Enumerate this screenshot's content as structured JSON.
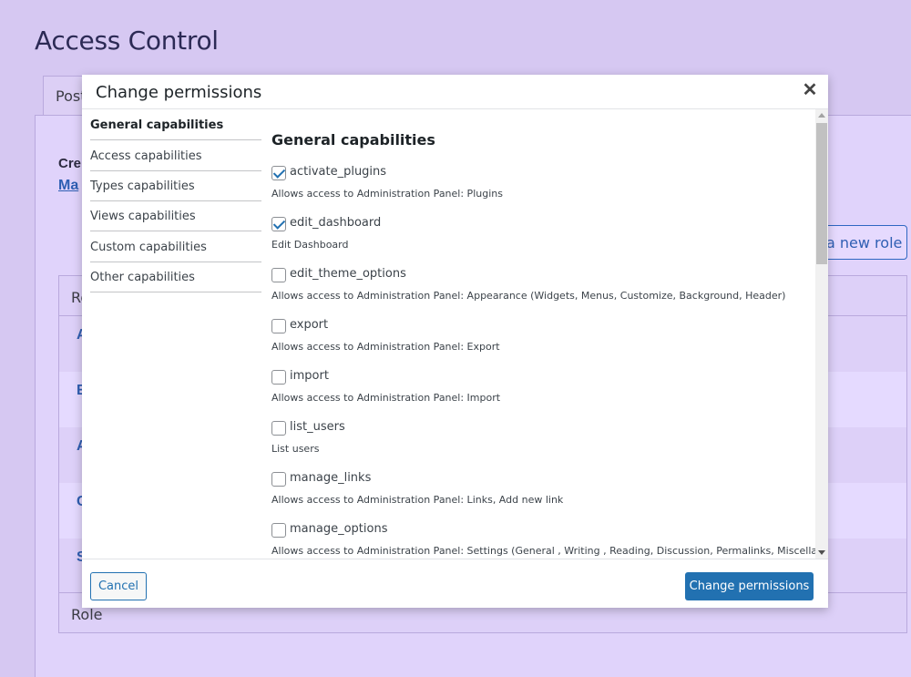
{
  "background": {
    "page_title": "Access Control",
    "tab_label": "Post",
    "create_text": "Cre",
    "manage_link": "Ma",
    "add_role_button": "a new role",
    "table_header": "Ro",
    "table_footer": "Role",
    "row_letters": [
      "A",
      "E",
      "A",
      "C",
      "S"
    ]
  },
  "modal": {
    "title": "Change permissions",
    "close_glyph": "✕",
    "nav_items": [
      {
        "label": "General capabilities",
        "active": true
      },
      {
        "label": "Access capabilities",
        "active": false
      },
      {
        "label": "Types capabilities",
        "active": false
      },
      {
        "label": "Views capabilities",
        "active": false
      },
      {
        "label": "Custom capabilities",
        "active": false
      },
      {
        "label": "Other capabilities",
        "active": false
      }
    ],
    "section_title": "General capabilities",
    "capabilities": [
      {
        "name": "activate_plugins",
        "description": "Allows access to Administration Panel: Plugins",
        "checked": true
      },
      {
        "name": "edit_dashboard",
        "description": "Edit Dashboard",
        "checked": true
      },
      {
        "name": "edit_theme_options",
        "description": "Allows access to Administration Panel: Appearance (Widgets, Menus, Customize, Background, Header)",
        "checked": false
      },
      {
        "name": "export",
        "description": "Allows access to Administration Panel: Export",
        "checked": false
      },
      {
        "name": "import",
        "description": "Allows access to Administration Panel: Import",
        "checked": false
      },
      {
        "name": "list_users",
        "description": "List users",
        "checked": false
      },
      {
        "name": "manage_links",
        "description": "Allows access to Administration Panel: Links, Add new link",
        "checked": false
      },
      {
        "name": "manage_options",
        "description": "Allows access to Administration Panel: Settings (General , Writing , Reading, Discussion, Permalinks, Miscellaneous)",
        "checked": false
      }
    ],
    "cancel_label": "Cancel",
    "submit_label": "Change permissions"
  },
  "colors": {
    "background": "#d6c8f2",
    "accent": "#2271b1",
    "link": "#2f5fb3"
  }
}
